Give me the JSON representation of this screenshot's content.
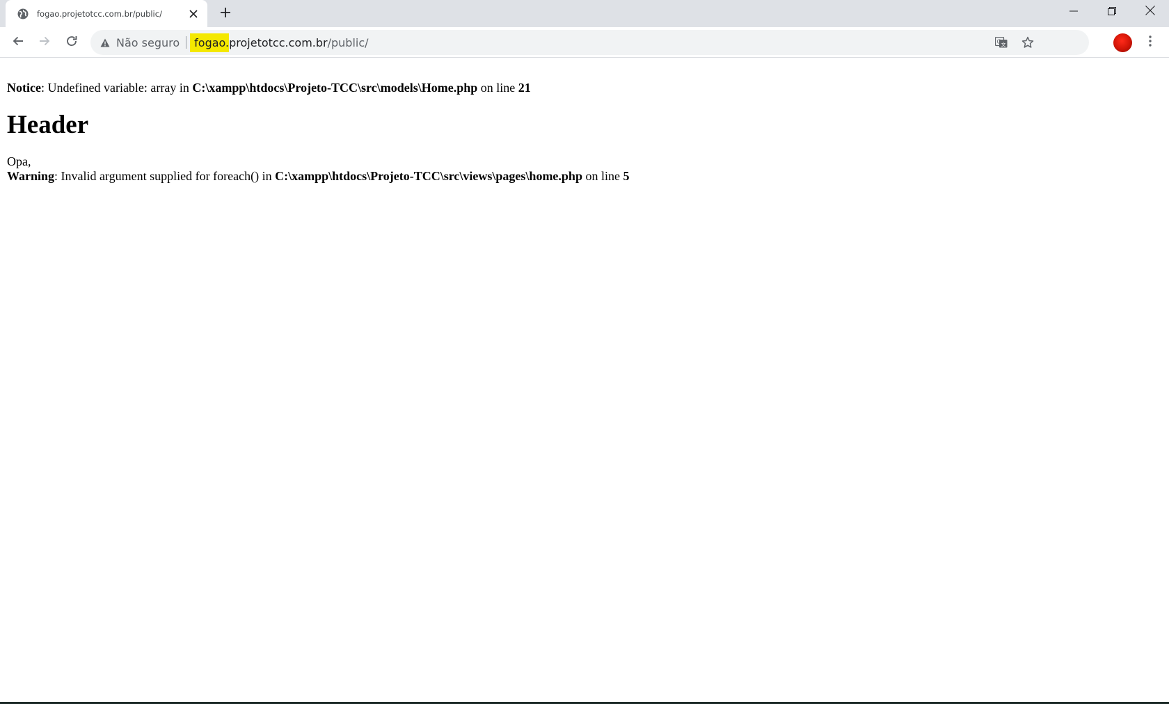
{
  "tab": {
    "title": "fogao.projetotcc.com.br/public/",
    "favicon_icon": "globe-icon",
    "close_icon": "close-icon"
  },
  "tabstrip": {
    "new_tab_icon": "plus-icon"
  },
  "window_controls": {
    "minimize_icon": "minimize-icon",
    "restore_icon": "restore-icon",
    "close_icon": "close-icon"
  },
  "toolbar": {
    "back_icon": "back-arrow-icon",
    "forward_icon": "forward-arrow-icon",
    "reload_icon": "reload-icon"
  },
  "omnibox": {
    "security_label": "Não seguro",
    "url_highlighted": "fogao.",
    "url_domain": "projetotcc.com.br",
    "url_path": "/public/",
    "highlight_color": "#f4e800"
  },
  "page": {
    "notice": {
      "label": "Notice",
      "text": ": Undefined variable: array in ",
      "path": "C:\\xampp\\htdocs\\Projeto-TCC\\src\\models\\Home.php",
      "on_line": " on line ",
      "line_no": "21"
    },
    "heading": "Header",
    "greeting": "Opa,",
    "warning": {
      "label": "Warning",
      "text": ": Invalid argument supplied for foreach() in ",
      "path": "C:\\xampp\\htdocs\\Projeto-TCC\\src\\views\\pages\\home.php",
      "on_line": " on line ",
      "line_no": "5"
    }
  }
}
